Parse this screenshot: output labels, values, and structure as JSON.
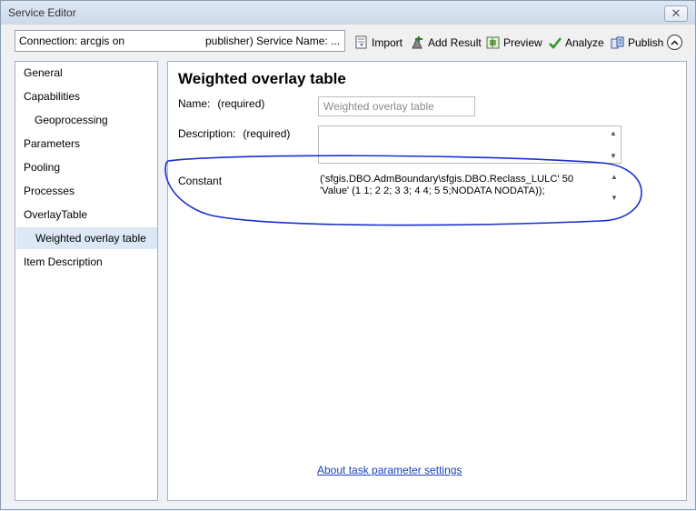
{
  "window": {
    "title": "Service Editor",
    "close_label": "✕"
  },
  "toolbar": {
    "connection_part1": "Connection: arcgis on",
    "connection_part2": "publisher)  Service Name: ...",
    "buttons": {
      "import": "Import",
      "add_result": "Add Result",
      "preview": "Preview",
      "analyze": "Analyze",
      "publish": "Publish"
    }
  },
  "nav": {
    "items": [
      {
        "label": "General"
      },
      {
        "label": "Capabilities"
      },
      {
        "label": "Geoprocessing"
      },
      {
        "label": "Parameters"
      },
      {
        "label": "Pooling"
      },
      {
        "label": "Processes"
      },
      {
        "label": "OverlayTable"
      },
      {
        "label": "Weighted overlay table",
        "selected": true
      },
      {
        "label": "Item Description"
      }
    ]
  },
  "panel": {
    "title": "Weighted overlay table",
    "name_label": "Name:",
    "name_req": "(required)",
    "name_value": "Weighted overlay table",
    "description_label": "Description:",
    "description_req": "(required)",
    "description_value": "",
    "constant_label": "Constant",
    "constant_value": "('sfgis.DBO.AdmBoundary\\sfgis.DBO.Reclass_LULC' 50 'Value' (1 1; 2 2; 3 3; 4 4; 5 5;NODATA NODATA));",
    "help_link": "About task parameter settings"
  },
  "icons": [
    "import-icon",
    "add-result-icon",
    "preview-icon",
    "analyze-check-icon",
    "publish-icon",
    "collapse-chevron-icon"
  ],
  "colors": {
    "link": "#1a3fbf",
    "annotation": "#1a2fd0",
    "analyze_check": "#2a9a2a",
    "selected_row": "#dce8f5"
  }
}
